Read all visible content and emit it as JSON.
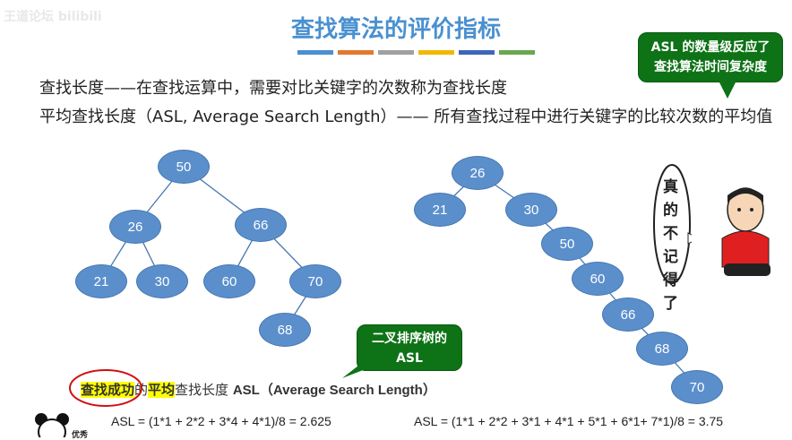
{
  "watermark": "王道论坛 bilibili",
  "title": "查找算法的评价指标",
  "title_bar_colors": [
    "#4a8fd0",
    "#e07a30",
    "#a0a0a0",
    "#f2b800",
    "#3f66b8",
    "#6aa84f"
  ],
  "definitions": [
    "查找长度——在查找运算中，需要对比关键字的次数称为查找长度",
    "平均查找长度（ASL, Average Search Length）—— 所有查找过程中进行关键字的比较次数的平均值"
  ],
  "callout_top": {
    "line1": "ASL 的数量级反应了",
    "line2": "查找算法时间复杂度"
  },
  "callout_bottom": {
    "line1": "二叉排序树的",
    "line2": "ASL"
  },
  "character_bubble": "真的不记得了",
  "tree1": {
    "nodes": [
      "50",
      "26",
      "66",
      "21",
      "30",
      "60",
      "70",
      "68"
    ]
  },
  "tree2": {
    "nodes": [
      "26",
      "21",
      "30",
      "50",
      "60",
      "66",
      "68",
      "70"
    ]
  },
  "asl_heading": {
    "part1": "查找成功",
    "part2": "的",
    "part3": "平均",
    "part4": "查找长度 ",
    "part5": "ASL（Average Search Length）"
  },
  "formula1": "ASL = (1*1 + 2*2 + 3*4 + 4*1)/8 = 2.625",
  "formula2": "ASL = (1*1 + 2*2 + 3*1 + 4*1 + 5*1 + 6*1+  7*1)/8 = 3.75",
  "meme_caption": "优秀",
  "colors": {
    "node": "#5b8fcc",
    "callout": "#0e7216",
    "title": "#4a90d0",
    "highlight": "#ffff00"
  }
}
